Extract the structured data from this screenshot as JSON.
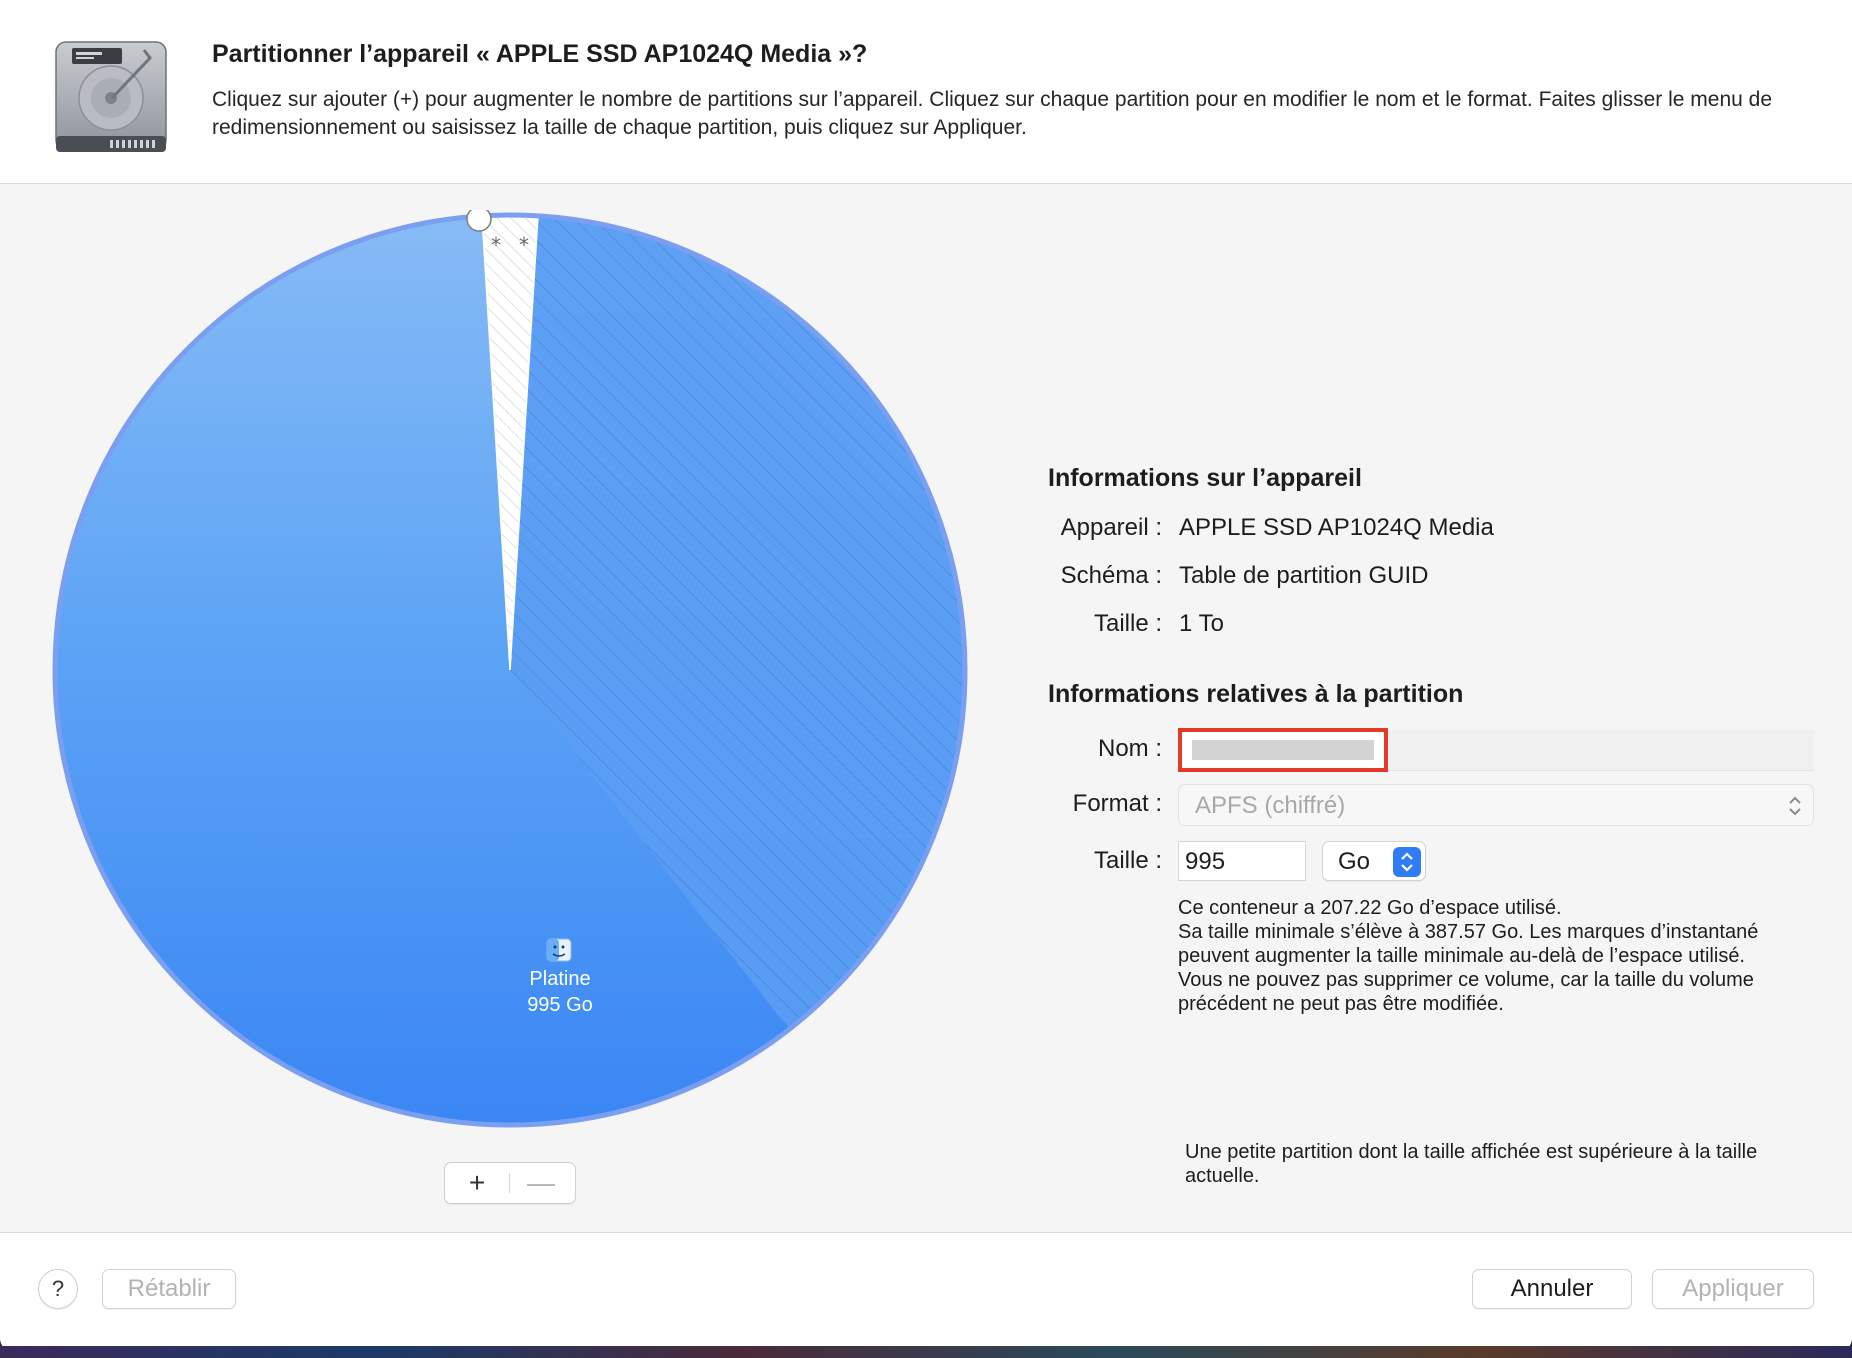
{
  "header": {
    "title": "Partitionner l’appareil « APPLE SSD AP1024Q Media »?",
    "description": "Cliquez sur ajouter (+) pour augmenter le nombre de partitions sur l’appareil. Cliquez sur chaque partition pour en modifier le nom et le format. Faites glisser le menu de redimensionnement ou saisissez la taille de chaque partition, puis cliquez sur Appliquer."
  },
  "pie": {
    "partition_name": "Platine",
    "partition_size": "995 Go",
    "small_marks": [
      "*",
      "*"
    ],
    "colors": {
      "main": "#4f9bf6",
      "outline": "#7b9ff0"
    }
  },
  "controls": {
    "add_label": "+",
    "remove_label": "—"
  },
  "device_info": {
    "title": "Informations sur l’appareil",
    "rows": [
      {
        "label": "Appareil :",
        "value": "APPLE SSD AP1024Q Media"
      },
      {
        "label": "Schéma :",
        "value": "Table de partition GUID"
      },
      {
        "label": "Taille :",
        "value": "1 To"
      }
    ]
  },
  "partition_info": {
    "title": "Informations relatives à la partition",
    "name_label": "Nom :",
    "name_value": "",
    "format_label": "Format :",
    "format_value": "APFS (chiffré)",
    "size_label": "Taille :",
    "size_value": "995",
    "unit_value": "Go",
    "notes": [
      "Ce conteneur a 207.22 Go d’espace utilisé.",
      "Sa taille minimale s’élève à 387.57 Go. Les marques d’instantané peuvent augmenter la taille minimale au-delà de l’espace utilisé.",
      "Vous ne pouvez pas supprimer ce volume, car la taille du volume précédent ne peut pas être modifiée."
    ],
    "small_partition_note": "Une petite partition dont la taille affichée est supérieure à la taille actuelle."
  },
  "footer": {
    "help_label": "?",
    "reset_label": "Rétablir",
    "cancel_label": "Annuler",
    "apply_label": "Appliquer"
  }
}
